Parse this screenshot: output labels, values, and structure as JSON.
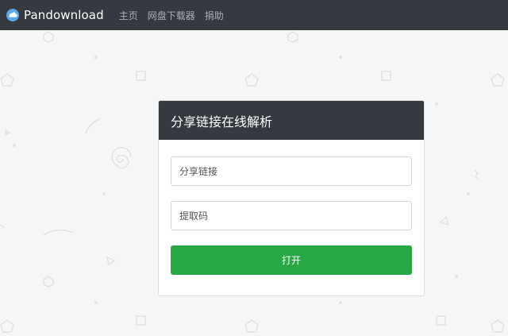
{
  "navbar": {
    "brand": "Pandownload",
    "links": [
      "主页",
      "网盘下载器",
      "捐助"
    ]
  },
  "card": {
    "title": "分享链接在线解析",
    "share_link_placeholder": "分享链接",
    "extract_code_placeholder": "提取码",
    "open_button": "打开"
  },
  "colors": {
    "navbar_bg": "#343a40",
    "button_green": "#28a745",
    "page_bg": "#f5f6f7"
  },
  "icons": {
    "brand": "cloud-icon"
  }
}
